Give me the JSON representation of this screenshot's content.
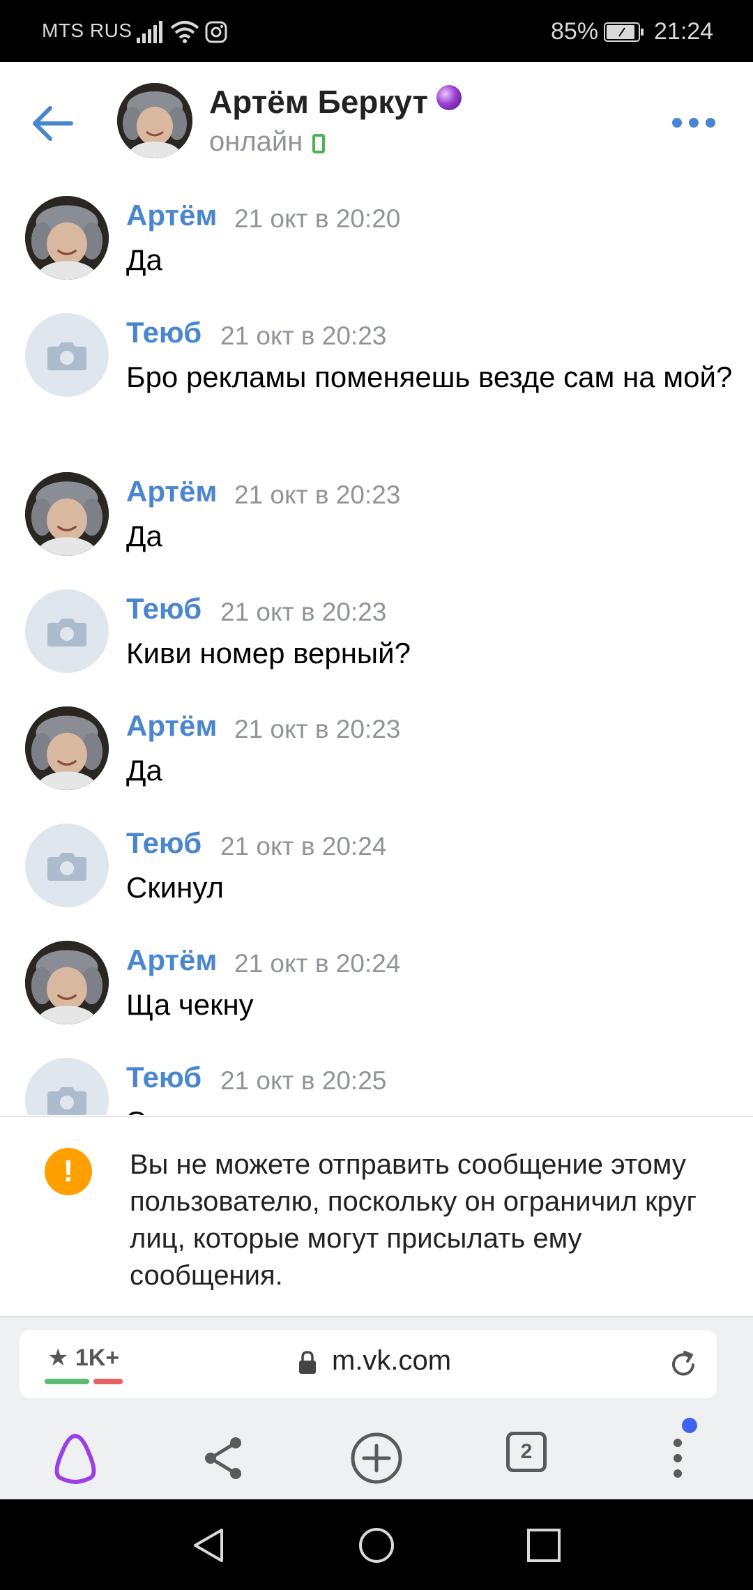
{
  "status_bar": {
    "carrier": "MTS RUS",
    "battery_percent": "85%",
    "time": "21:24"
  },
  "header": {
    "name": "Артём Беркут",
    "status": "онлайн"
  },
  "messages": [
    {
      "author": "Артём",
      "time": "21 окт в 20:20",
      "text": "Да",
      "avatar": "photo"
    },
    {
      "author": "Теюб",
      "time": "21 окт в 20:23",
      "text": "Бро рекламы поменяешь везде сам на мой?",
      "avatar": "camera-placeholder"
    },
    {
      "author": "Артём",
      "time": "21 окт в 20:23",
      "text": "Да",
      "avatar": "photo"
    },
    {
      "author": "Теюб",
      "time": "21 окт в 20:23",
      "text": "Киви номер верный?",
      "avatar": "camera-placeholder"
    },
    {
      "author": "Артём",
      "time": "21 окт в 20:23",
      "text": "Да",
      "avatar": "photo"
    },
    {
      "author": "Теюб",
      "time": "21 окт в 20:24",
      "text": "Скинул",
      "avatar": "camera-placeholder"
    },
    {
      "author": "Артём",
      "time": "21 окт в 20:24",
      "text": "Ща чекну",
      "avatar": "photo"
    },
    {
      "author": "Теюб",
      "time": "21 окт в 20:25",
      "text": "Это номер заказа",
      "avatar": "camera-placeholder"
    }
  ],
  "notice": {
    "icon": "!",
    "text": "Вы не можете отправить сообщение этому пользователю, поскольку он ограничил круг лиц, которые могут присылать ему сообщения."
  },
  "browser": {
    "rating": "★ 1K+",
    "url": "m.vk.com",
    "tabs_count": "2"
  },
  "colors": {
    "accent": "#4a86cf",
    "warning": "#ffa000",
    "online": "#4bb34b",
    "alice": "#9b3fe6"
  }
}
